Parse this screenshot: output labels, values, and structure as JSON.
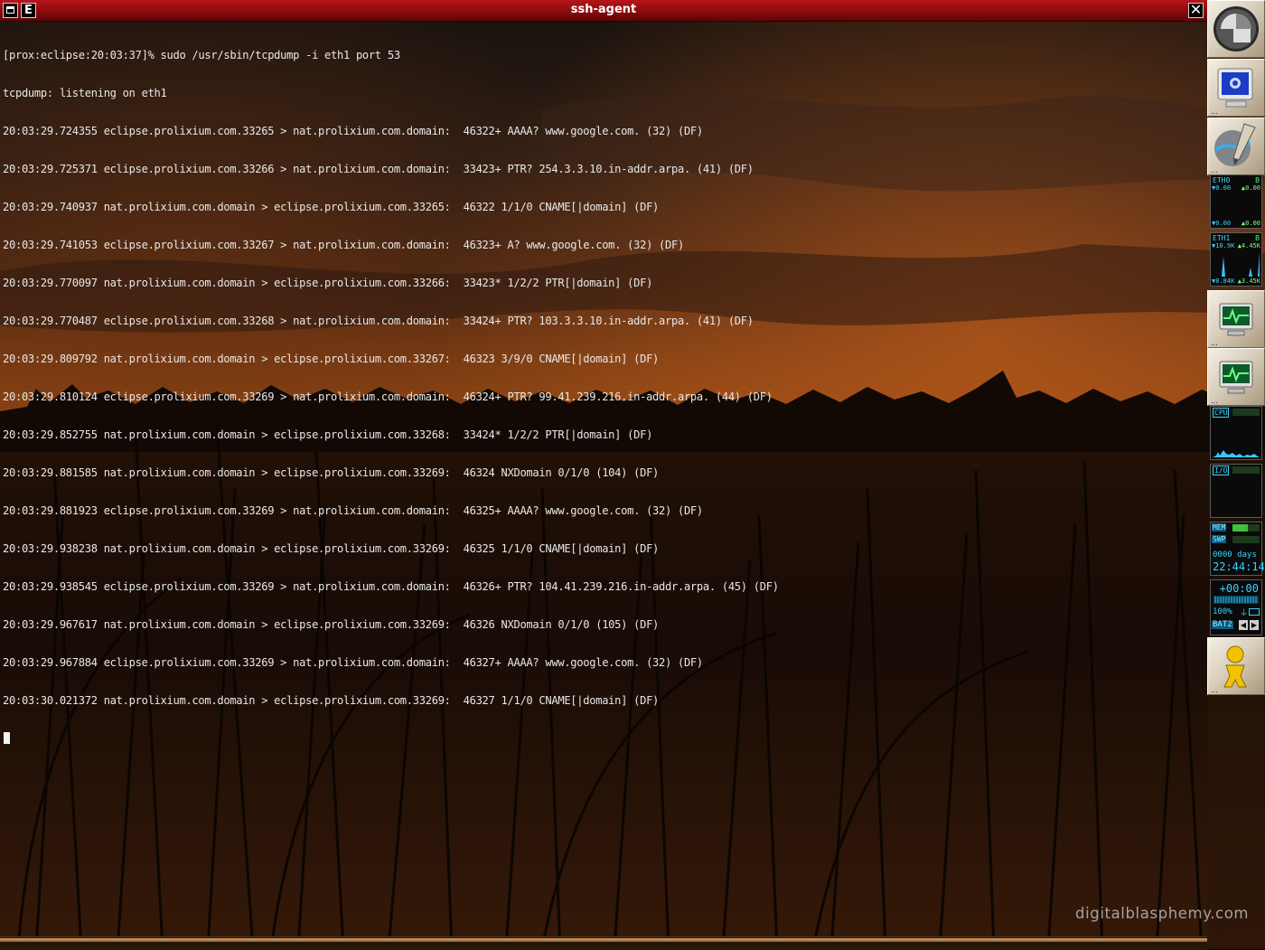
{
  "window": {
    "title": "ssh-agent",
    "menu_button_label": "E",
    "close_button_label": "✕"
  },
  "terminal": {
    "lines": [
      "[prox:eclipse:20:03:37]% sudo /usr/sbin/tcpdump -i eth1 port 53",
      "tcpdump: listening on eth1",
      "20:03:29.724355 eclipse.prolixium.com.33265 > nat.prolixium.com.domain:  46322+ AAAA? www.google.com. (32) (DF)",
      "20:03:29.725371 eclipse.prolixium.com.33266 > nat.prolixium.com.domain:  33423+ PTR? 254.3.3.10.in-addr.arpa. (41) (DF)",
      "20:03:29.740937 nat.prolixium.com.domain > eclipse.prolixium.com.33265:  46322 1/1/0 CNAME[|domain] (DF)",
      "20:03:29.741053 eclipse.prolixium.com.33267 > nat.prolixium.com.domain:  46323+ A? www.google.com. (32) (DF)",
      "20:03:29.770097 nat.prolixium.com.domain > eclipse.prolixium.com.33266:  33423* 1/2/2 PTR[|domain] (DF)",
      "20:03:29.770487 eclipse.prolixium.com.33268 > nat.prolixium.com.domain:  33424+ PTR? 103.3.3.10.in-addr.arpa. (41) (DF)",
      "20:03:29.809792 nat.prolixium.com.domain > eclipse.prolixium.com.33267:  46323 3/9/0 CNAME[|domain] (DF)",
      "20:03:29.810124 eclipse.prolixium.com.33269 > nat.prolixium.com.domain:  46324+ PTR? 99.41.239.216.in-addr.arpa. (44) (DF)",
      "20:03:29.852755 nat.prolixium.com.domain > eclipse.prolixium.com.33268:  33424* 1/2/2 PTR[|domain] (DF)",
      "20:03:29.881585 nat.prolixium.com.domain > eclipse.prolixium.com.33269:  46324 NXDomain 0/1/0 (104) (DF)",
      "20:03:29.881923 eclipse.prolixium.com.33269 > nat.prolixium.com.domain:  46325+ AAAA? www.google.com. (32) (DF)",
      "20:03:29.938238 nat.prolixium.com.domain > eclipse.prolixium.com.33269:  46325 1/1/0 CNAME[|domain] (DF)",
      "20:03:29.938545 eclipse.prolixium.com.33269 > nat.prolixium.com.domain:  46326+ PTR? 104.41.239.216.in-addr.arpa. (45) (DF)",
      "20:03:29.967617 nat.prolixium.com.domain > eclipse.prolixium.com.33269:  46326 NXDomain 0/1/0 (105) (DF)",
      "20:03:29.967884 eclipse.prolixium.com.33269 > nat.prolixium.com.domain:  46327+ AAAA? www.google.com. (32) (DF)",
      "20:03:30.021372 nat.prolixium.com.domain > eclipse.prolixium.com.33269:  46327 1/1/0 CNAME[|domain] (DF)"
    ]
  },
  "dock": {
    "dots": "...",
    "tiles": [
      {
        "icon": "dock-logo-icon"
      },
      {
        "icon": "computer-monitor-icon"
      },
      {
        "icon": "graphics-app-icon"
      },
      {
        "icon": "system-monitor-icon"
      },
      {
        "icon": "system-monitor-icon"
      },
      {
        "icon": "user-figure-icon"
      }
    ],
    "eth0": {
      "label": "ETH0",
      "flag": "B",
      "rx": "▼0.00",
      "tx": "▲0.00",
      "rx_total": "▼0.00",
      "tx_total": "▲0.00"
    },
    "eth1": {
      "label": "ETH1",
      "flag": "B",
      "rx": "▼10.9K",
      "tx": "▲4.45K",
      "rx_total": "▼8.84K",
      "tx_total": "▲3.45K"
    },
    "cpu": {
      "label": "CPU"
    },
    "io": {
      "label": "I/O"
    },
    "mem": {
      "mem_label": "MEM",
      "swp_label": "SWP",
      "mem_level": 0.55,
      "swp_level": 0.0
    },
    "uptime": {
      "days": "0000 days",
      "time": "22:44:14"
    },
    "battery": {
      "offset": "+00:00",
      "percent": "100%",
      "battery_label": "BAT2"
    }
  },
  "desktop": {
    "watermark": "digitalblasphemy.com"
  },
  "colors": {
    "titlebar": "#a3161a",
    "terminal_text": "#e8e8e8",
    "monitor_text": "#35d4ff"
  }
}
